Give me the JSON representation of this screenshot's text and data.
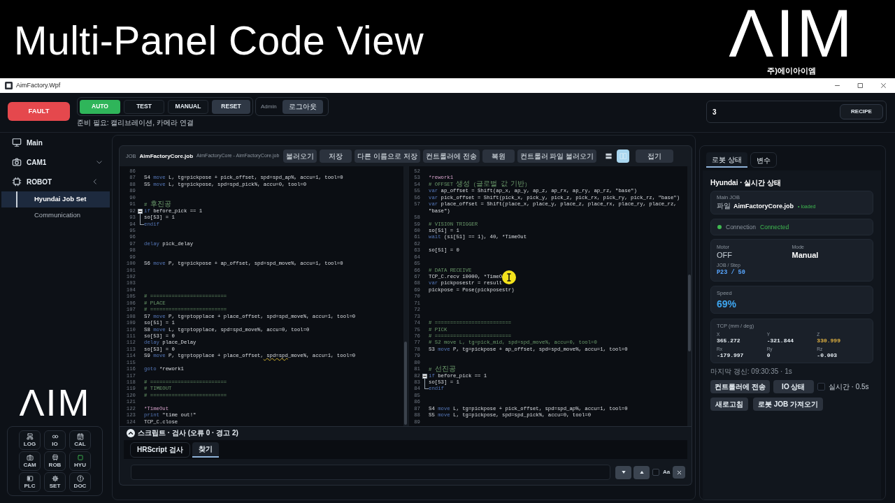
{
  "banner": {
    "title": "Multi-Panel Code View",
    "logo": "ΛIM",
    "company": "주)에이아이엠"
  },
  "window": {
    "title": "AimFactory.Wpf"
  },
  "header": {
    "fault_button": "FAULT",
    "modes": [
      {
        "label": "AUTO",
        "selected": true
      },
      {
        "label": "TEST",
        "selected": false
      },
      {
        "label": "MANUAL",
        "selected": false
      }
    ],
    "reset_button": "RESET",
    "user_role": "Admin",
    "logout_button": "로그아웃",
    "status_message": "준비 필요: 캘리브레이션, 카메라 연결",
    "recipe_field": {
      "value": "3"
    },
    "recipe_button": "RECIPE"
  },
  "sidebar": {
    "items": [
      {
        "label": "Main",
        "selected": false
      },
      {
        "label": "CAM1",
        "selected": false,
        "expanded": false
      },
      {
        "label": "ROBOT",
        "selected": false,
        "expanded": true,
        "children": [
          {
            "label": "Hyundai Job Set",
            "selected": true
          },
          {
            "label": "Communication",
            "selected": false
          }
        ]
      }
    ],
    "logo": "ΛIM",
    "shortcuts": [
      {
        "label": "LOG",
        "active": false
      },
      {
        "label": "IO",
        "active": false
      },
      {
        "label": "CAL",
        "active": false
      },
      {
        "label": "CAM",
        "active": false
      },
      {
        "label": "ROB",
        "active": false
      },
      {
        "label": "HYU",
        "active": true
      },
      {
        "label": "PLC",
        "active": false
      },
      {
        "label": "SET",
        "active": false
      },
      {
        "label": "DOC",
        "active": false
      }
    ]
  },
  "editor": {
    "job_label": "JOB",
    "file_name": "AimFactoryCore.job",
    "file_path": "AimFactoryCore - AimFactoryCore.job",
    "buttons": [
      "불러오기",
      "저장",
      "다른 이름으로 저장",
      "컨트롤러에 전송",
      "복원",
      "컨트롤러 파일 불러오기"
    ],
    "view_toggles": [
      {
        "selected": false
      },
      {
        "selected": true
      }
    ],
    "collapse_button": "접기",
    "panes": [
      {
        "lines": [
          {
            "number": "86"
          },
          {
            "number": "87",
            "segments": [
              {
                "kind": "plain",
                "text": "S4 "
              },
              {
                "kind": "keyword",
                "text": "move"
              },
              {
                "kind": "plain",
                "text": " L, tg=pickpose + pick_offset, spd=spd_ap%, accu=1, tool=0"
              }
            ]
          },
          {
            "number": "88",
            "segments": [
              {
                "kind": "plain",
                "text": "S5 "
              },
              {
                "kind": "keyword",
                "text": "move"
              },
              {
                "kind": "plain",
                "text": " L, tg=pickpose, spd=spd_pick%, accu=0, tool=0"
              }
            ]
          },
          {
            "number": "89"
          },
          {
            "number": "90"
          },
          {
            "number": "91",
            "segments": [
              {
                "kind": "comment",
                "text": "# 후진공"
              }
            ]
          },
          {
            "number": "92",
            "fold_start": true,
            "segments": [
              {
                "kind": "keyword",
                "text": "if"
              },
              {
                "kind": "plain",
                "text": " before_pick == 1"
              }
            ]
          },
          {
            "number": "93",
            "in_fold": true,
            "segments": [
              {
                "kind": "plain",
                "text": "so[53] = 1"
              }
            ]
          },
          {
            "number": "94",
            "fold_end": true,
            "segments": [
              {
                "kind": "keyword",
                "text": "endif"
              }
            ]
          },
          {
            "number": "95"
          },
          {
            "number": "96"
          },
          {
            "number": "97",
            "segments": [
              {
                "kind": "keyword",
                "text": "delay"
              },
              {
                "kind": "plain",
                "text": " pick_delay"
              }
            ]
          },
          {
            "number": "98"
          },
          {
            "number": "99"
          },
          {
            "number": "100",
            "segments": [
              {
                "kind": "plain",
                "text": "S6 "
              },
              {
                "kind": "keyword",
                "text": "move"
              },
              {
                "kind": "plain",
                "text": " P, tg=pickpose + ap_offset, spd=spd_move%, accu=1, tool=0"
              }
            ]
          },
          {
            "number": "101"
          },
          {
            "number": "102"
          },
          {
            "number": "103"
          },
          {
            "number": "104"
          },
          {
            "number": "105",
            "segments": [
              {
                "kind": "comment",
                "text": "# ========================="
              }
            ]
          },
          {
            "number": "106",
            "segments": [
              {
                "kind": "comment",
                "text": "# PLACE"
              }
            ]
          },
          {
            "number": "107",
            "segments": [
              {
                "kind": "comment",
                "text": "# ========================="
              }
            ]
          },
          {
            "number": "108",
            "segments": [
              {
                "kind": "plain",
                "text": "S7 "
              },
              {
                "kind": "keyword",
                "text": "move"
              },
              {
                "kind": "plain",
                "text": " P, tg=ptopplace + place_offset, spd=spd_move%, accu=1, tool=0"
              }
            ]
          },
          {
            "number": "109",
            "segments": [
              {
                "kind": "plain",
                "text": "so[51] = 1"
              }
            ]
          },
          {
            "number": "110",
            "segments": [
              {
                "kind": "plain",
                "text": "S8 "
              },
              {
                "kind": "keyword",
                "text": "move"
              },
              {
                "kind": "plain",
                "text": " L, tg=ptopplace, spd=spd_move%, accu=0, tool=0"
              }
            ]
          },
          {
            "number": "111",
            "segments": [
              {
                "kind": "plain",
                "text": "so[53] = 0"
              }
            ]
          },
          {
            "number": "112",
            "segments": [
              {
                "kind": "keyword",
                "text": "delay"
              },
              {
                "kind": "plain",
                "text": " place_Delay"
              }
            ]
          },
          {
            "number": "113",
            "segments": [
              {
                "kind": "plain",
                "text": "so[53] = 0"
              }
            ]
          },
          {
            "number": "114",
            "segments": [
              {
                "kind": "plain",
                "text": "S9 "
              },
              {
                "kind": "keyword",
                "text": "move"
              },
              {
                "kind": "plain",
                "text": " P, tg=ptopplace + place_offset,"
              },
              {
                "kind": "warning",
                "text": " spd=spd"
              },
              {
                "kind": "plain",
                "text": "_move%, accu=1, tool=0"
              }
            ]
          },
          {
            "number": "115"
          },
          {
            "number": "116",
            "segments": [
              {
                "kind": "keyword",
                "text": "goto"
              },
              {
                "kind": "plain",
                "text": " *rework1"
              }
            ]
          },
          {
            "number": "117"
          },
          {
            "number": "118",
            "segments": [
              {
                "kind": "comment",
                "text": "# ========================="
              }
            ]
          },
          {
            "number": "119",
            "segments": [
              {
                "kind": "comment",
                "text": "# TIMEOUT"
              }
            ]
          },
          {
            "number": "120",
            "segments": [
              {
                "kind": "comment",
                "text": "# ========================="
              }
            ]
          },
          {
            "number": "121"
          },
          {
            "number": "122",
            "segments": [
              {
                "kind": "label",
                "text": "*TimeOut"
              }
            ]
          },
          {
            "number": "123",
            "segments": [
              {
                "kind": "keyword",
                "text": "print"
              },
              {
                "kind": "plain",
                "text": " \"time out!\""
              }
            ]
          },
          {
            "number": "124",
            "segments": [
              {
                "kind": "plain",
                "text": "TCP_C.close"
              }
            ]
          }
        ]
      },
      {
        "lines": [
          {
            "number": "52"
          },
          {
            "number": "53",
            "segments": [
              {
                "kind": "label",
                "text": "*rework1"
              }
            ]
          },
          {
            "number": "54",
            "segments": [
              {
                "kind": "comment",
                "text": "# OFFSET 생성 (글로벌 값 기반)"
              }
            ]
          },
          {
            "number": "55",
            "segments": [
              {
                "kind": "keyword",
                "text": "var"
              },
              {
                "kind": "plain",
                "text": " ap_offset = Shift(ap_x, ap_y, ap_z, ap_rx, ap_ry, ap_rz, \"base\")"
              }
            ]
          },
          {
            "number": "56",
            "segments": [
              {
                "kind": "keyword",
                "text": "var"
              },
              {
                "kind": "plain",
                "text": " pick_offset = Shift(pick_x, pick_y, pick_z, pick_rx, pick_ry, pick_rz, \"base\")"
              }
            ]
          },
          {
            "number": "57",
            "segments": [
              {
                "kind": "keyword",
                "text": "var"
              },
              {
                "kind": "plain",
                "text": " place_offset = Shift(place_x, place_y, place_z, place_rx, place_ry, place_rz,"
              }
            ]
          },
          {
            "segments": [
              {
                "kind": "plain",
                "text": "\"base\")"
              }
            ]
          },
          {
            "number": "58"
          },
          {
            "number": "59",
            "segments": [
              {
                "kind": "comment",
                "text": "# VISION TRIGGER"
              }
            ]
          },
          {
            "number": "60",
            "segments": [
              {
                "kind": "plain",
                "text": "so[51] = 1"
              }
            ]
          },
          {
            "number": "61",
            "segments": [
              {
                "kind": "keyword",
                "text": "wait"
              },
              {
                "kind": "plain",
                "text": " (si[51] == 1), 40, *TimeOut"
              }
            ]
          },
          {
            "number": "62"
          },
          {
            "number": "63",
            "segments": [
              {
                "kind": "plain",
                "text": "so[51] = 0"
              }
            ]
          },
          {
            "number": "64"
          },
          {
            "number": "65"
          },
          {
            "number": "66",
            "segments": [
              {
                "kind": "comment",
                "text": "# DATA RECEIVE"
              }
            ]
          },
          {
            "number": "67",
            "pointer": true,
            "segments": [
              {
                "kind": "plain",
                "text": "TCP_C.recv 10000, *TimeO"
              }
            ]
          },
          {
            "number": "68",
            "segments": [
              {
                "kind": "keyword",
                "text": "var"
              },
              {
                "kind": "plain",
                "text": " pickposestr = result"
              }
            ]
          },
          {
            "number": "69",
            "segments": [
              {
                "kind": "plain",
                "text": "pickpose = Pose(pickposestr)"
              }
            ]
          },
          {
            "number": "70"
          },
          {
            "number": "71"
          },
          {
            "number": "72"
          },
          {
            "number": "73"
          },
          {
            "number": "74",
            "segments": [
              {
                "kind": "comment",
                "text": "# ========================="
              }
            ]
          },
          {
            "number": "75",
            "segments": [
              {
                "kind": "comment",
                "text": "# PICK"
              }
            ]
          },
          {
            "number": "76",
            "segments": [
              {
                "kind": "comment",
                "text": "# ========================="
              }
            ]
          },
          {
            "number": "77",
            "segments": [
              {
                "kind": "comment",
                "text": "# S2 move L, tg=pick_mid, spd=spd_move%, accu=0, tool=0"
              }
            ]
          },
          {
            "number": "78",
            "segments": [
              {
                "kind": "plain",
                "text": "S3 "
              },
              {
                "kind": "keyword",
                "text": "move"
              },
              {
                "kind": "plain",
                "text": " P, tg=pickpose + ap_offset, spd=spd_move%, accu=1, tool=0"
              }
            ]
          },
          {
            "number": "79"
          },
          {
            "number": "80"
          },
          {
            "number": "81",
            "segments": [
              {
                "kind": "comment",
                "text": "# 선진공"
              }
            ]
          },
          {
            "number": "82",
            "fold_start": true,
            "segments": [
              {
                "kind": "keyword",
                "text": "if"
              },
              {
                "kind": "plain",
                "text": " before_pick == 1"
              }
            ]
          },
          {
            "number": "83",
            "in_fold": true,
            "segments": [
              {
                "kind": "plain",
                "text": "so[53] = 1"
              }
            ]
          },
          {
            "number": "84",
            "fold_end": true,
            "segments": [
              {
                "kind": "keyword",
                "text": "endif"
              }
            ]
          },
          {
            "number": "85"
          },
          {
            "number": "86"
          },
          {
            "number": "87",
            "segments": [
              {
                "kind": "plain",
                "text": "S4 "
              },
              {
                "kind": "keyword",
                "text": "move"
              },
              {
                "kind": "plain",
                "text": " L, tg=pickpose + pick_offset, spd=spd_ap%, accu=1, tool=0"
              }
            ]
          },
          {
            "number": "88",
            "segments": [
              {
                "kind": "plain",
                "text": "S5 "
              },
              {
                "kind": "keyword",
                "text": "move"
              },
              {
                "kind": "plain",
                "text": " L, tg=pickpose, spd=spd_pick%, accu=0, tool=0"
              }
            ]
          },
          {
            "number": "89"
          }
        ]
      }
    ]
  },
  "problems": {
    "title": "스크립트 · 검사 (오류 0 · 경고 2)",
    "expanded": true,
    "tabs": [
      {
        "label": "HRScript 검사",
        "selected": false
      },
      {
        "label": "찾기",
        "selected": true
      }
    ],
    "search": {
      "match_case": false,
      "match_case_label": "Aa"
    }
  },
  "robot_panel": {
    "tabs": [
      {
        "label": "로봇 상태",
        "selected": true
      },
      {
        "label": "변수",
        "selected": false
      }
    ],
    "title": "Hyundai · 실시간 상태",
    "main_job": {
      "label": "Main JOB",
      "prefix": "파일",
      "file": "AimFactoryCore.job",
      "status": "• loaded"
    },
    "connection": {
      "label": "Connection",
      "value": "Connected",
      "connected": true
    },
    "motor": {
      "label": "Motor",
      "value": "OFF"
    },
    "mode": {
      "label": "Mode",
      "value": "Manual"
    },
    "job_step": {
      "label": "JOB / Step",
      "value": "P23 / 50"
    },
    "speed": {
      "label": "Speed",
      "value": "69%"
    },
    "tcp": {
      "label": "TCP (mm / deg)",
      "values": [
        {
          "axis": "X",
          "value": "365.272",
          "highlighted": false
        },
        {
          "axis": "Y",
          "value": "-321.844",
          "highlighted": false
        },
        {
          "axis": "Z",
          "value": "330.999",
          "highlighted": true
        },
        {
          "axis": "Rx",
          "value": "-179.997",
          "highlighted": false
        },
        {
          "axis": "Ry",
          "value": "0",
          "highlighted": false
        },
        {
          "axis": "Rz",
          "value": "-0.003",
          "highlighted": false
        }
      ]
    },
    "last_update": "마지막 갱신: 09:30:35 · 1s",
    "send_button": "컨트롤러에 전송",
    "io_button": "IO 상태",
    "realtime": {
      "label": "실시간 · 0.5s",
      "checked": false
    },
    "refresh_button": "새로고침",
    "fetch_button": "로봇 JOB 가져오기"
  }
}
